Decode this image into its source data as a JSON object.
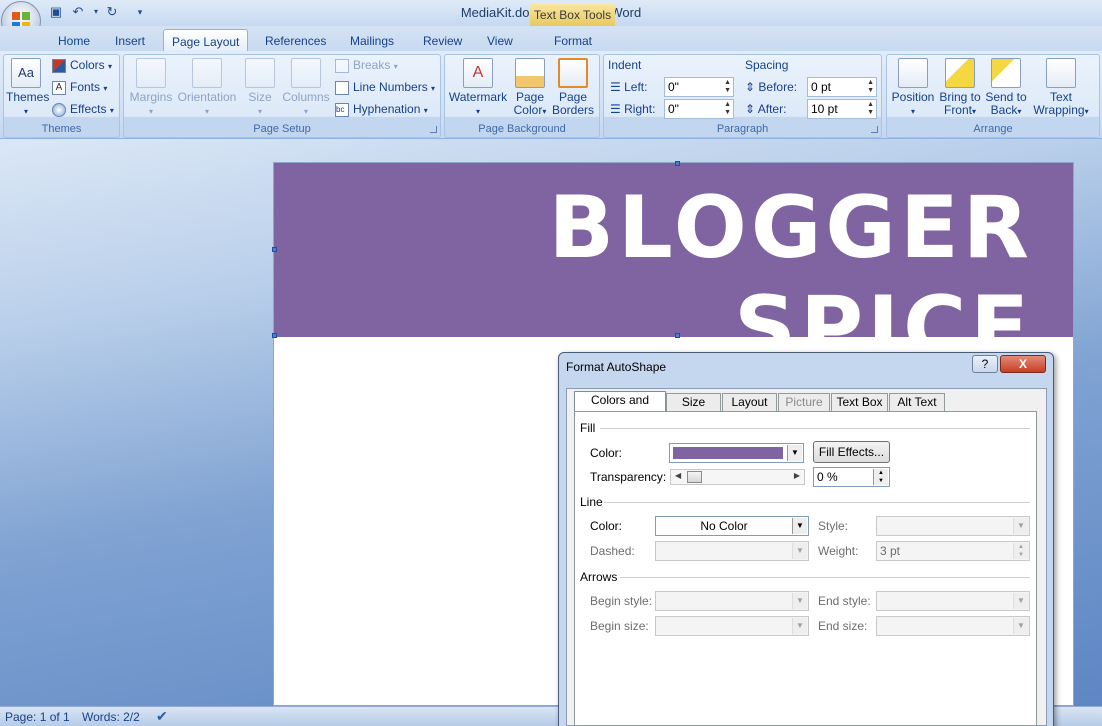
{
  "window": {
    "title": "MediaKit.docx - Microsoft Word",
    "contextual_tab_group": "Text Box Tools"
  },
  "qat": {
    "save_icon": "save-icon",
    "undo_icon": "undo-icon",
    "redo_icon": "redo-icon",
    "customize_icon": "customize-icon"
  },
  "tabs": [
    "Home",
    "Insert",
    "Page Layout",
    "References",
    "Mailings",
    "Review",
    "View",
    "Format"
  ],
  "active_tab": "Page Layout",
  "ribbon": {
    "themes": {
      "label": "Themes",
      "themes_btn": "Themes",
      "colors": "Colors",
      "fonts": "Fonts",
      "effects": "Effects"
    },
    "page_setup": {
      "label": "Page Setup",
      "margins": "Margins",
      "orientation": "Orientation",
      "size": "Size",
      "columns": "Columns",
      "breaks": "Breaks",
      "line_numbers": "Line Numbers",
      "hyphenation": "Hyphenation"
    },
    "page_background": {
      "label": "Page Background",
      "watermark": "Watermark",
      "page_color_1": "Page",
      "page_color_2": "Color",
      "page_borders_1": "Page",
      "page_borders_2": "Borders"
    },
    "paragraph": {
      "label": "Paragraph",
      "indent": "Indent",
      "left_label": "Left:",
      "left_value": "0\"",
      "right_label": "Right:",
      "right_value": "0\"",
      "spacing": "Spacing",
      "before_label": "Before:",
      "before_value": "0 pt",
      "after_label": "After:",
      "after_value": "10 pt"
    },
    "arrange": {
      "label": "Arrange",
      "position": "Position",
      "bring_front_1": "Bring to",
      "bring_front_2": "Front",
      "send_back_1": "Send to",
      "send_back_2": "Back",
      "text_wrap_1": "Text",
      "text_wrap_2": "Wrapping"
    }
  },
  "document": {
    "banner_text": "BLOGGER SPICE",
    "banner_color": "#8064a2"
  },
  "status": {
    "page": "Page: 1 of 1",
    "words": "Words: 2/2"
  },
  "dialog": {
    "title": "Format AutoShape",
    "help": "?",
    "close": "X",
    "tabs": [
      "Colors and Lines",
      "Size",
      "Layout",
      "Picture",
      "Text Box",
      "Alt Text"
    ],
    "fill": {
      "section": "Fill",
      "color_label": "Color:",
      "color_value": "#8064a2",
      "fill_effects": "Fill Effects...",
      "transparency_label": "Transparency:",
      "transparency_value": "0 %"
    },
    "line": {
      "section": "Line",
      "color_label": "Color:",
      "color_value": "No Color",
      "style_label": "Style:",
      "dashed_label": "Dashed:",
      "weight_label": "Weight:",
      "weight_value": "3 pt"
    },
    "arrows": {
      "section": "Arrows",
      "begin_style": "Begin style:",
      "end_style": "End style:",
      "begin_size": "Begin size:",
      "end_size": "End size:"
    }
  }
}
